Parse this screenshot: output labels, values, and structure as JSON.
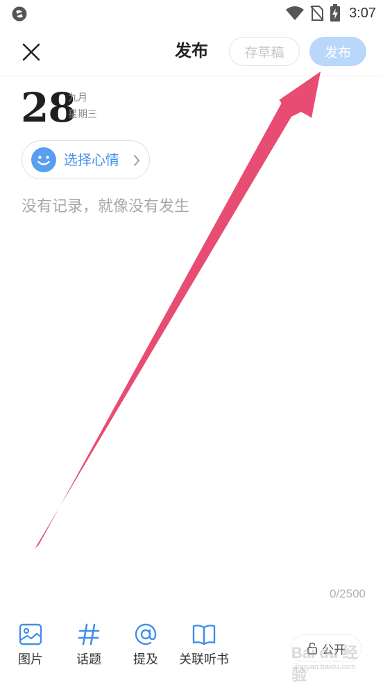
{
  "status_bar": {
    "time": "3:07"
  },
  "header": {
    "title": "发布",
    "draft_label": "存草稿",
    "publish_label": "发布"
  },
  "date": {
    "day": "28",
    "month": "九月",
    "weekday": "星期三"
  },
  "mood": {
    "label": "选择心情"
  },
  "editor": {
    "placeholder": "没有记录，就像没有发生",
    "char_count": "0/2500"
  },
  "toolbar": {
    "items": [
      {
        "label": "图片",
        "icon": "image-icon"
      },
      {
        "label": "话题",
        "icon": "hashtag-icon"
      },
      {
        "label": "提及",
        "icon": "at-icon"
      },
      {
        "label": "关联听书",
        "icon": "book-icon"
      }
    ],
    "privacy_label": "公开"
  },
  "watermark": {
    "main": "Bai du 经验",
    "sub": "jingyan.baidu.com"
  },
  "colors": {
    "accent_blue": "#3f8fec",
    "publish_disabled": "#b9d6fb",
    "annotation_arrow": "#e84c72"
  }
}
